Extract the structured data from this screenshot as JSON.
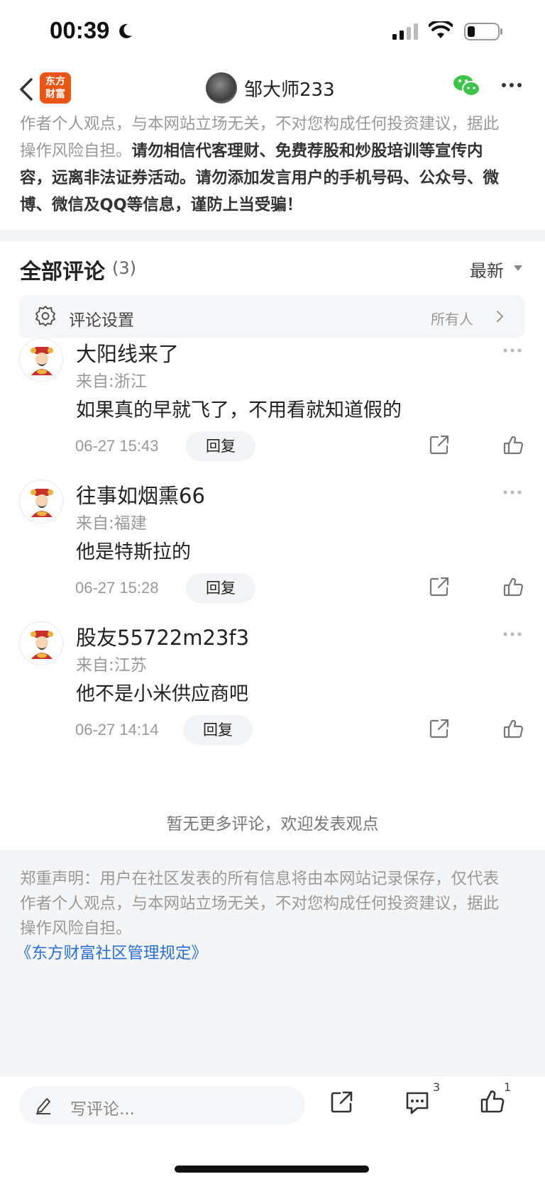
{
  "status_bar": {
    "time": "00:39",
    "icons": [
      "moon-icon",
      "cellular-signal-icon",
      "wifi-icon",
      "battery-icon"
    ]
  },
  "nav": {
    "app_logo_line1": "东方",
    "app_logo_line2": "财富",
    "author_name": "邹大师233",
    "icons": [
      "back-icon",
      "wechat-icon",
      "more-icon"
    ]
  },
  "top_disclaimer": {
    "line1": "作者个人观点，与本网站立场无关，不对您构成任何投资建议，据此",
    "line2_plain": "操作风险自担。",
    "line2_bold": "请勿相信代客理财、免费荐股和炒股培训等宣传内",
    "line3_bold": "容，远离非法证券活动。请勿添加发言用户的手机号码、公众号、微",
    "line4_bold": "博、微信及QQ等信息，谨防上当受骗！"
  },
  "comments_header": {
    "title": "全部评论",
    "count": "(3)",
    "sort": "最新"
  },
  "settings": {
    "label": "评论设置",
    "value": "所有人"
  },
  "comments": [
    {
      "name": "大阳线来了",
      "location": "来自:浙江",
      "text": "如果真的早就飞了，不用看就知道假的",
      "time": "06-27 15:43",
      "reply_label": "回复"
    },
    {
      "name": "往事如烟熏66",
      "location": "来自:福建",
      "text": "他是特斯拉的",
      "time": "06-27 15:28",
      "reply_label": "回复"
    },
    {
      "name": "股友55722m23f3",
      "location": "来自:江苏",
      "text": "他不是小米供应商吧",
      "time": "06-27 14:14",
      "reply_label": "回复"
    }
  ],
  "no_more": "暂无更多评论，欢迎发表观点",
  "bottom_disclaimer": {
    "line1": "郑重声明：用户在社区发表的所有信息将由本网站记录保存，仅代表",
    "line2": "作者个人观点，与本网站立场无关，不对您构成任何投资建议，据此",
    "line3": "操作风险自担。",
    "link": "《东方财富社区管理规定》"
  },
  "toolbar": {
    "placeholder": "写评论...",
    "comment_count": "3",
    "like_count": "1"
  },
  "colors": {
    "brand": "#ea5513",
    "link": "#2a6fd6",
    "wechat": "#3cc44b"
  }
}
